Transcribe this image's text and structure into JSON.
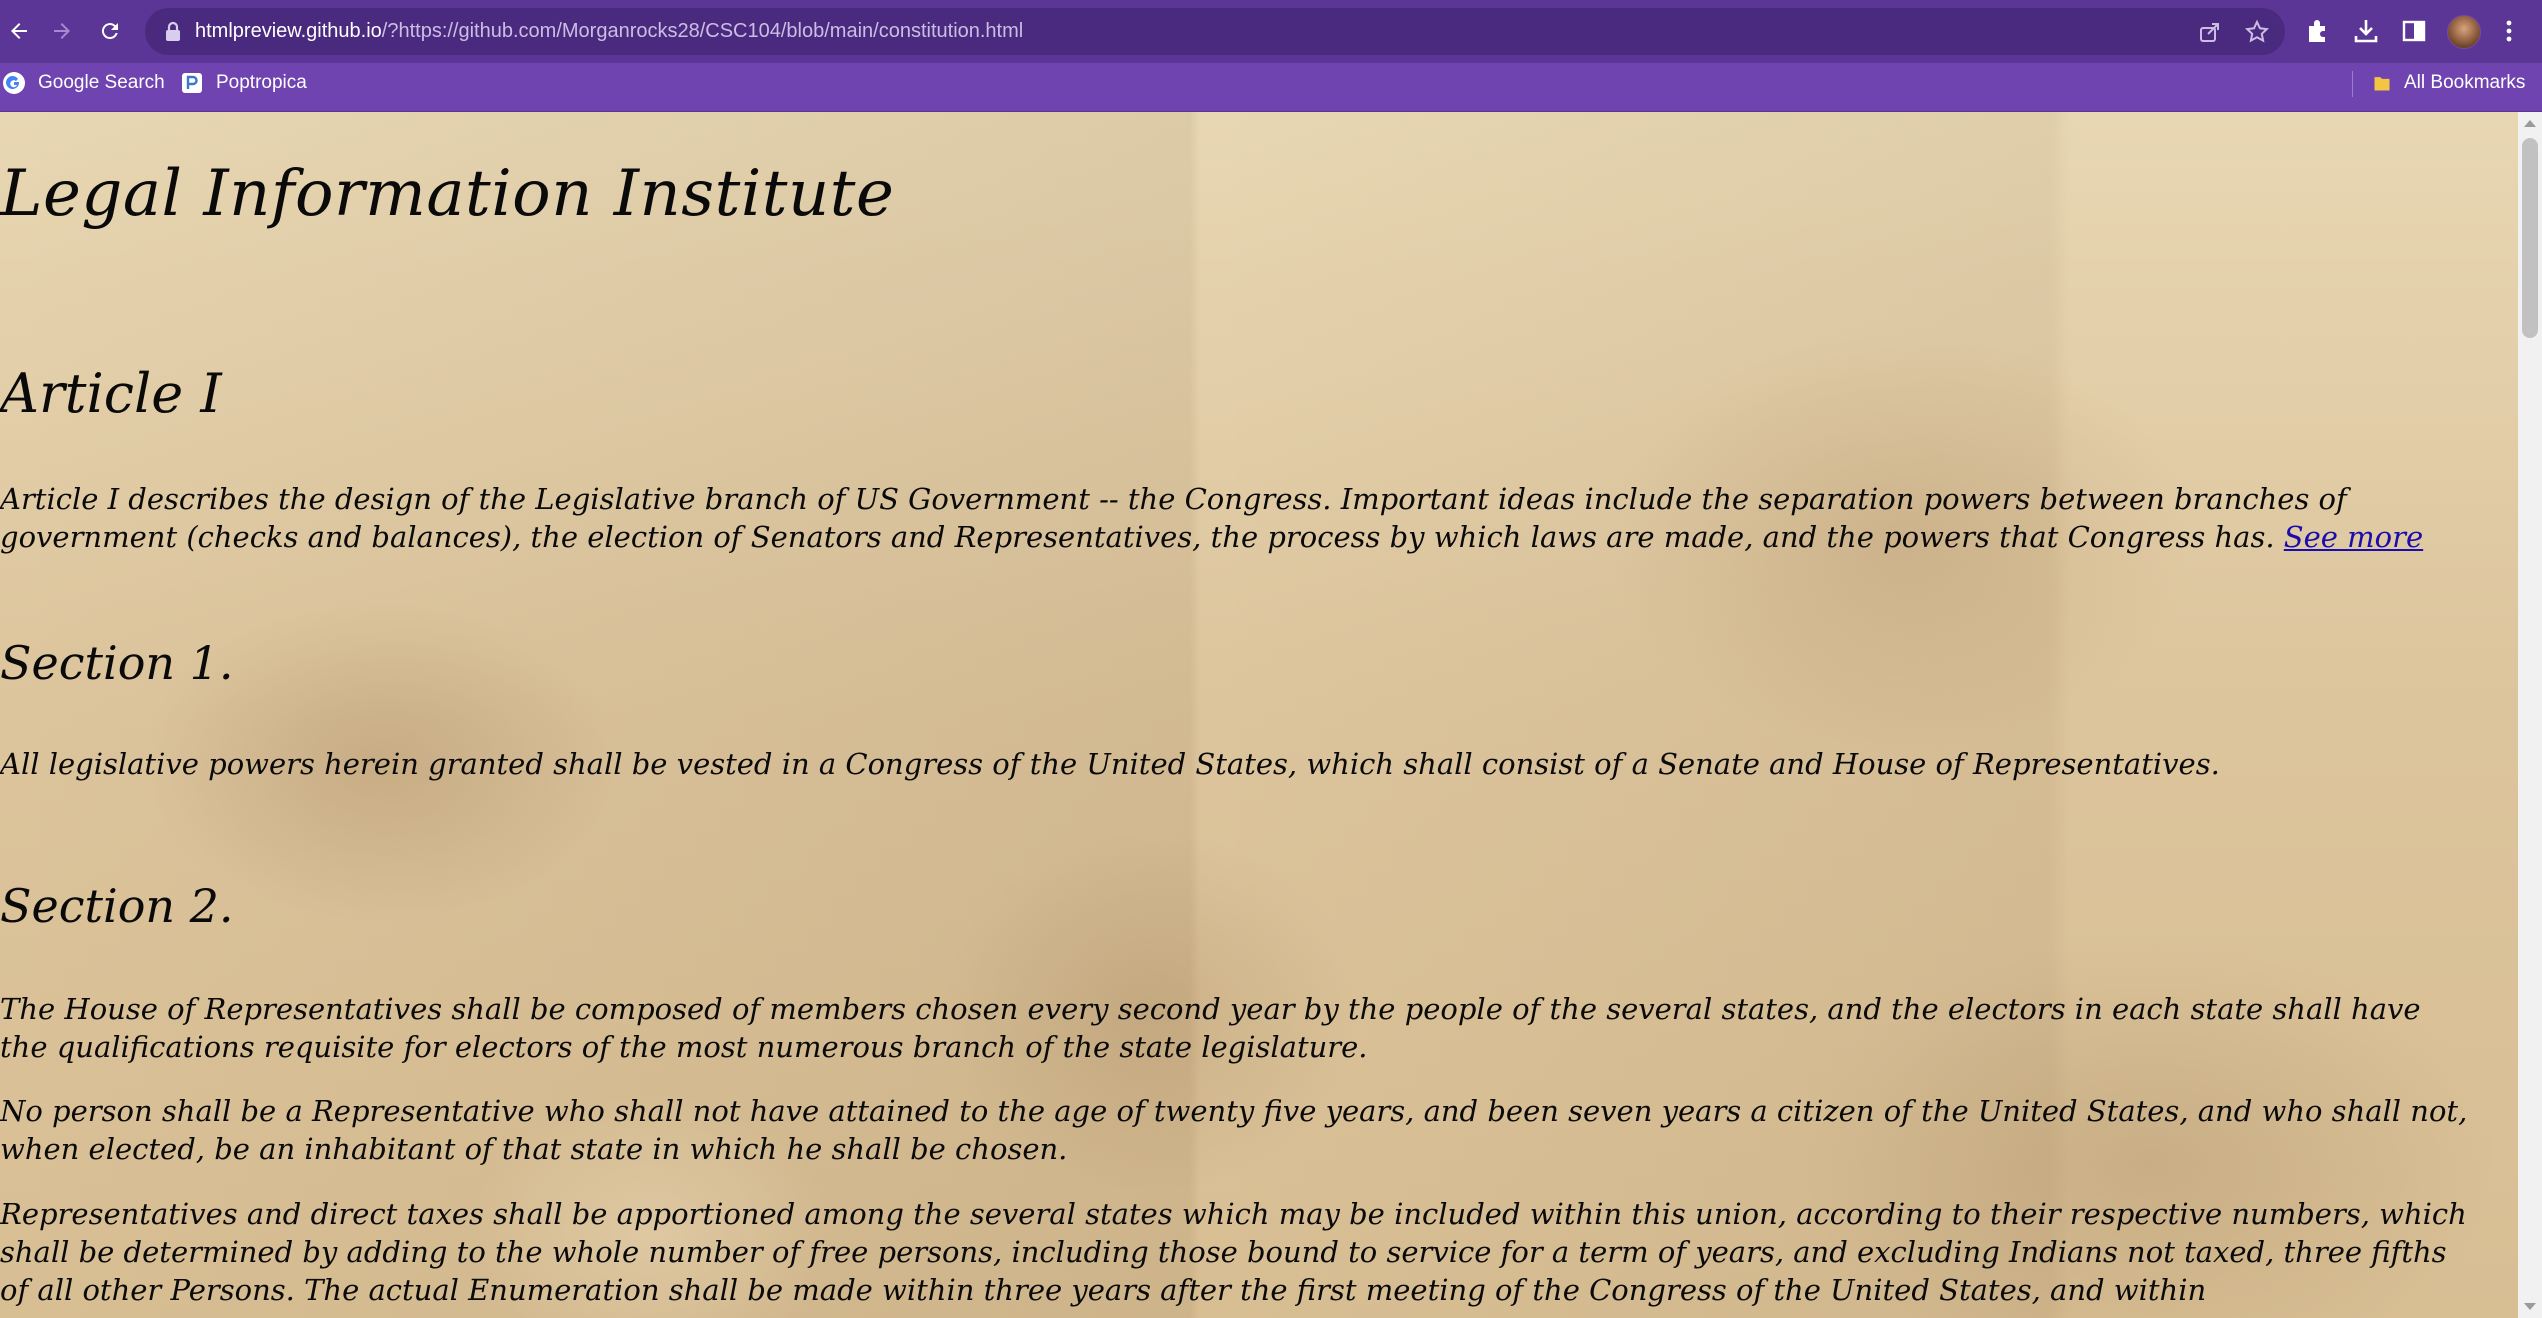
{
  "browser": {
    "url_host": "htmlpreview.github.io",
    "url_rest": "/?https://github.com/Morganrocks28/CSC104/blob/main/constitution.html",
    "bookmarks": [
      {
        "label": "Google Search",
        "icon": "google-icon"
      },
      {
        "label": "Poptropica",
        "icon": "poptropica-icon"
      }
    ],
    "all_bookmarks_label": "All Bookmarks"
  },
  "page": {
    "title": "Legal Information Institute",
    "article_heading": "Article I",
    "article_summary": "Article I describes the design of the Legislative branch of US Government -- the Congress. Important ideas include the separation powers between branches of government (checks and balances), the election of Senators and Representatives, the process by which laws are made, and the powers that Congress has.",
    "see_more_label": "See more",
    "section1_heading": "Section 1.",
    "section1_text": "All legislative powers herein granted shall be vested in a Congress of the United States, which shall consist of a Senate and House of Representatives.",
    "section2_heading": "Section 2.",
    "section2_p1": "The House of Representatives shall be composed of members chosen every second year by the people of the several states, and the electors in each state shall have the qualifications requisite for electors of the most numerous branch of the state legislature.",
    "section2_p2": "No person shall be a Representative who shall not have attained to the age of twenty five years, and been seven years a citizen of the United States, and who shall not, when elected, be an inhabitant of that state in which he shall be chosen.",
    "section2_p3": "Representatives and direct taxes shall be apportioned among the several states which may be included within this union, according to their respective numbers, which shall be determined by adding to the whole number of free persons, including those bound to service for a term of years, and excluding Indians not taxed, three fifths of all other Persons. The actual Enumeration shall be made within three years after the first meeting of the Congress of the United States, and within"
  },
  "colors": {
    "toolbar": "#5b3696",
    "bookmarks_bar": "#6f43b0",
    "link": "#1a0dab"
  }
}
